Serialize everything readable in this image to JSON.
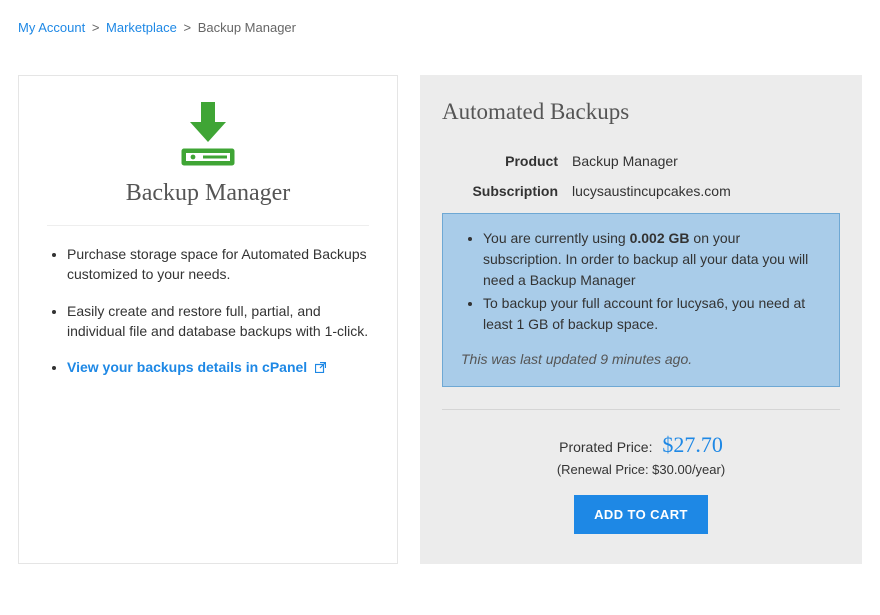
{
  "breadcrumb": {
    "account": "My Account",
    "marketplace": "Marketplace",
    "current": "Backup Manager"
  },
  "card": {
    "title": "Backup Manager",
    "bullets": [
      "Purchase storage space for Automated Backups customized to your needs.",
      "Easily create and restore full, partial, and individual file and database backups with 1-click."
    ],
    "link_text": "View your backups details in cPanel"
  },
  "panel": {
    "title": "Automated Backups",
    "product_label": "Product",
    "product_value": "Backup Manager",
    "subscription_label": "Subscription",
    "subscription_value": "lucysaustincupcakes.com",
    "notice": {
      "line1_pre": "You are currently using ",
      "usage": "0.002 GB",
      "line1_post": " on your subscription. In order to backup all your data you will need a Backup Manager",
      "line2": "To backup your full account for lucysa6, you need at least 1 GB of backup space.",
      "updated": "This was last updated 9 minutes ago."
    },
    "prorated_label": "Prorated Price:",
    "prorated_price": "$27.70",
    "renewal": "(Renewal Price: $30.00/year)",
    "add_to_cart": "ADD TO CART"
  }
}
